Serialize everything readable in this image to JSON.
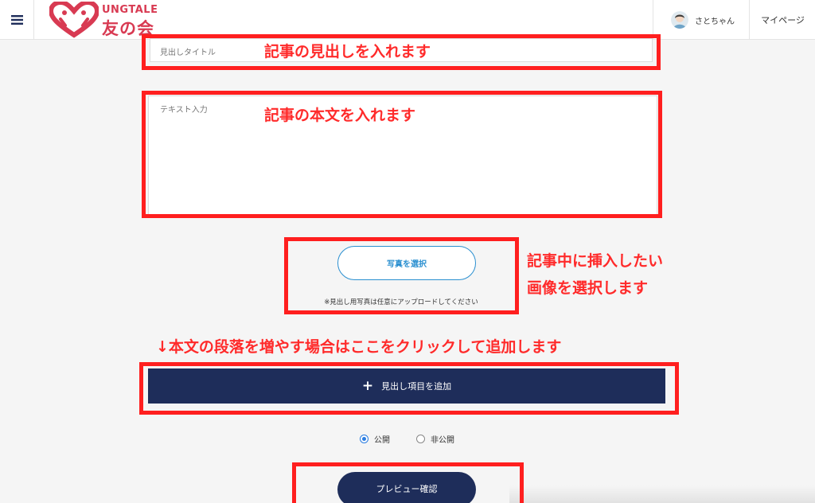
{
  "header": {
    "logo_top": "UNGTALE",
    "logo_main": "友の会",
    "user_name": "さとちゃん",
    "mypage": "マイページ"
  },
  "form": {
    "title_placeholder": "見出しタイトル",
    "text_placeholder": "テキスト入力",
    "photo_button": "写真を選択",
    "photo_note": "※見出し用写真は任意にアップロードしてください",
    "add_button": "見出し項目を追加",
    "add_plus": "+",
    "radio_public": "公開",
    "radio_private": "非公開",
    "preview_button": "プレビュー確認"
  },
  "annotations": {
    "title_note": "記事の見出しを入れます",
    "body_note": "記事の本文を入れます",
    "photo_note_line1": "記事中に挿入したい",
    "photo_note_line2": "画像を選択します",
    "add_note": "↓本文の段落を増やす場合はここをクリックして追加します"
  },
  "state": {
    "visibility": "公開"
  },
  "colors": {
    "brand": "#d83a52",
    "navy": "#1e2d5a",
    "annotation_red": "#ff2222",
    "button_blue": "#2a8fd0"
  },
  "icons": [
    "hamburger-menu-icon",
    "logo-heart-icon",
    "avatar-icon",
    "plus-icon",
    "radio-icon"
  ]
}
